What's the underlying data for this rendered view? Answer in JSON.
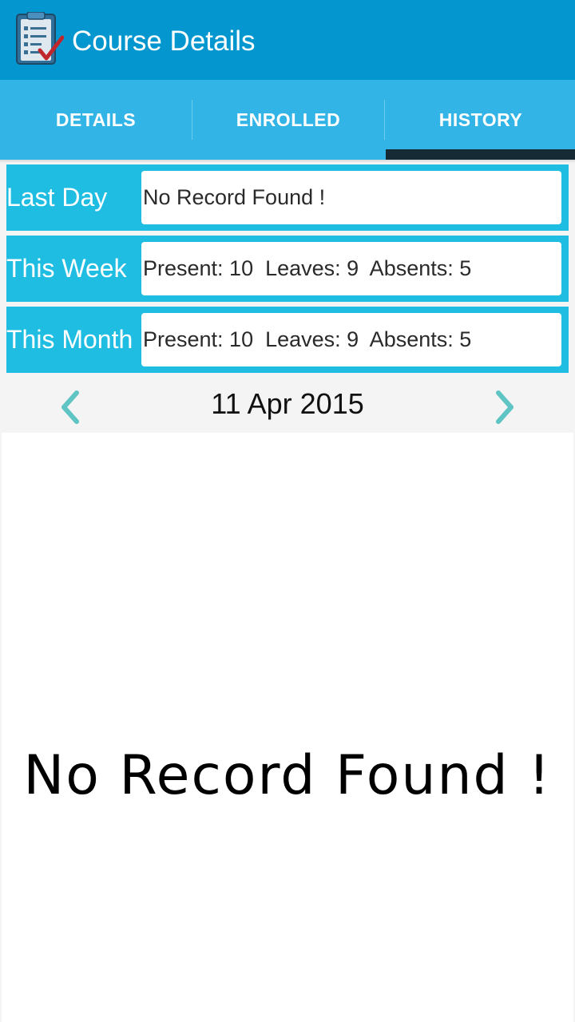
{
  "appbar": {
    "title": "Course Details",
    "icon": "checklist-clipboard-icon",
    "color": "#0497cf"
  },
  "tabs": [
    {
      "label": "DETAILS",
      "selected": false
    },
    {
      "label": "ENROLLED",
      "selected": false
    },
    {
      "label": "HISTORY",
      "selected": true
    }
  ],
  "stats": [
    {
      "label": "Last Day",
      "value": "No Record Found !"
    },
    {
      "label": "This Week",
      "value": "Present: 10  Leaves: 9  Absents: 5"
    },
    {
      "label": "This Month",
      "value": "Present: 10  Leaves: 9  Absents: 5"
    }
  ],
  "date_nav": {
    "date": "11 Apr 2015",
    "prev_icon": "chevron-left-icon",
    "next_icon": "chevron-right-icon"
  },
  "records": {
    "empty_message": "No Record Found !"
  },
  "colors": {
    "tabbar": "#33b4e6",
    "stat_row": "#20bde2",
    "indicator": "#152a35",
    "chevron": "#5ec4c4"
  }
}
